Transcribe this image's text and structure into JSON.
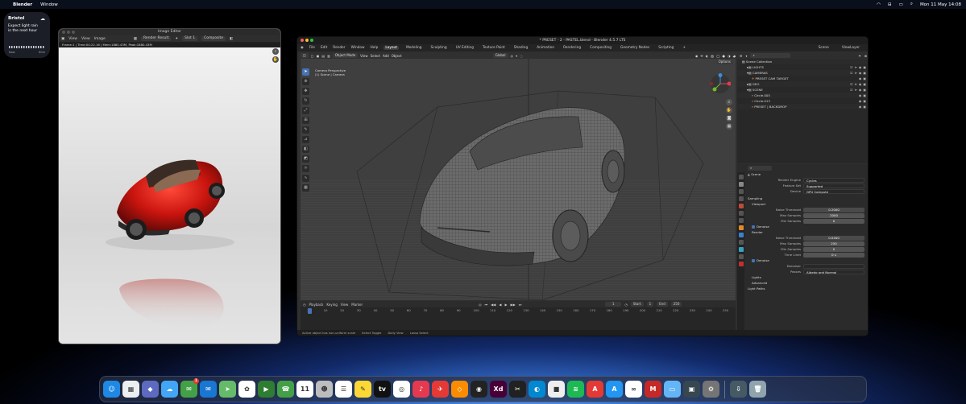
{
  "menubar": {
    "app": "Blender",
    "items": [
      "Window"
    ],
    "clock": "Mon 11 May  14:08"
  },
  "widget": {
    "city": "Bristol",
    "description": "Expect light rain in the next hour",
    "time_start": "Now",
    "time_end": "60m"
  },
  "image_editor": {
    "title": "Image Editor",
    "menu": [
      "View",
      "View",
      "Image"
    ],
    "image_name": "Render Result",
    "slot": "Slot 1",
    "pass": "Composite",
    "info": "Frame:1 | Time:04:22.16 | Mem:1880.43M, Peak:1880.43M"
  },
  "blender": {
    "title": "* PRESET - 2 - PASTEL.blend - Blender 4.5.7 LTS",
    "menu": [
      "File",
      "Edit",
      "Render",
      "Window",
      "Help"
    ],
    "workspaces": [
      "Layout",
      "Modeling",
      "Sculpting",
      "UV Editing",
      "Texture Paint",
      "Shading",
      "Animation",
      "Rendering",
      "Compositing",
      "Geometry Nodes",
      "Scripting",
      "+"
    ],
    "scene": "Scene",
    "view_layer": "ViewLayer",
    "viewport": {
      "mode": "Object Mode",
      "menu": [
        "View",
        "Select",
        "Add",
        "Object"
      ],
      "orientation": "Global",
      "options": "Options",
      "info_line1": "Camera Perspective",
      "info_line2": "(1) Scene | Camera"
    },
    "outliner": {
      "search_placeholder": "",
      "rows": [
        {
          "label": "Scene Collection",
          "level": 0
        },
        {
          "label": "LIGHTS",
          "level": 1
        },
        {
          "label": "CAMERAS",
          "level": 1
        },
        {
          "label": "PRESET CAM TARGET",
          "level": 2
        },
        {
          "label": "GEO",
          "level": 1
        },
        {
          "label": "SCENE",
          "level": 1
        },
        {
          "label": "Circle.005",
          "level": 2
        },
        {
          "label": "Circle.013",
          "level": 2
        },
        {
          "label": "PRESET | BACKDROP",
          "level": 2
        }
      ]
    },
    "properties": {
      "context": "Scene",
      "render_engine_label": "Render Engine",
      "render_engine": "Cycles",
      "feature_set_label": "Feature Set",
      "feature_set": "Supported",
      "device_label": "Device",
      "device": "GPU Compute",
      "sampling": "Sampling",
      "viewport": "Viewport",
      "noise_threshold_label": "Noise Threshold",
      "vp_noise_threshold": "0.2000",
      "max_samples_label": "Max Samples",
      "vp_max_samples": "2000",
      "min_samples_label": "Min Samples",
      "vp_min_samples": "0",
      "denoise": "Denoise",
      "render": "Render",
      "r_noise_threshold": "0.0400",
      "r_max_samples": "250",
      "r_min_samples": "0",
      "time_limit_label": "Time Limit",
      "r_time_limit": "0 s",
      "denoiser_label": "Denoiser",
      "passes_label": "Passes",
      "passes": "Albedo and Normal",
      "lights": "Lights",
      "advanced": "Advanced",
      "light_paths": "Light Paths",
      "version": "4.5.7"
    },
    "timeline": {
      "menu": [
        "Playback",
        "Keying",
        "View",
        "Marker"
      ],
      "current_frame": "1",
      "start_label": "Start",
      "start": "1",
      "end_label": "End",
      "end": "250",
      "ticks": [
        "1",
        "10",
        "20",
        "30",
        "40",
        "50",
        "60",
        "70",
        "80",
        "90",
        "100",
        "110",
        "120",
        "130",
        "140",
        "150",
        "160",
        "170",
        "180",
        "190",
        "200",
        "210",
        "220",
        "230",
        "240",
        "250"
      ]
    },
    "status_bar": [
      "Active object has non-uniform scale",
      "Select Toggle",
      "Dolly View",
      "Lasso Select"
    ]
  },
  "dock": {
    "apps": [
      {
        "name": "finder",
        "color": "#1e88e5",
        "glyph": "☺"
      },
      {
        "name": "launchpad",
        "color": "#eceff1",
        "glyph": "▦"
      },
      {
        "name": "affinity",
        "color": "#5c6bc0",
        "glyph": "◆"
      },
      {
        "name": "weather",
        "color": "#42a5f5",
        "glyph": "☁"
      },
      {
        "name": "messages",
        "color": "#43a047",
        "glyph": "✉",
        "badge": "1"
      },
      {
        "name": "mail",
        "color": "#1976d2",
        "glyph": "✉"
      },
      {
        "name": "maps",
        "color": "#66bb6a",
        "glyph": "➤"
      },
      {
        "name": "photos",
        "color": "#ffffff",
        "glyph": "✿"
      },
      {
        "name": "facetime",
        "color": "#2e7d32",
        "glyph": "▶"
      },
      {
        "name": "phone",
        "color": "#43a047",
        "glyph": "☎"
      },
      {
        "name": "calendar",
        "color": "#ffffff",
        "glyph": "11"
      },
      {
        "name": "contacts",
        "color": "#bdbdbd",
        "glyph": "☻"
      },
      {
        "name": "reminders",
        "color": "#ffffff",
        "glyph": "☰"
      },
      {
        "name": "notes",
        "color": "#fdd835",
        "glyph": "✎"
      },
      {
        "name": "apple-tv",
        "color": "#111111",
        "glyph": "tv"
      },
      {
        "name": "teams",
        "color": "#ffffff",
        "glyph": "◎"
      },
      {
        "name": "music",
        "color": "#e53950",
        "glyph": "♪"
      },
      {
        "name": "rocket",
        "color": "#e53935",
        "glyph": "✈"
      },
      {
        "name": "sketch",
        "color": "#fb8c00",
        "glyph": "◇"
      },
      {
        "name": "blender",
        "color": "#222222",
        "glyph": "◉"
      },
      {
        "name": "xd",
        "color": "#470137",
        "glyph": "Xd"
      },
      {
        "name": "final-cut",
        "color": "#212121",
        "glyph": "✂"
      },
      {
        "name": "edge",
        "color": "#0288d1",
        "glyph": "◐"
      },
      {
        "name": "cube-app",
        "color": "#eeeeee",
        "glyph": "■"
      },
      {
        "name": "spotify",
        "color": "#1db954",
        "glyph": "≋"
      },
      {
        "name": "acrobat",
        "color": "#e53935",
        "glyph": "A"
      },
      {
        "name": "app-store",
        "color": "#2196f3",
        "glyph": "A"
      },
      {
        "name": "creative-cloud",
        "color": "#ffffff",
        "glyph": "∞"
      },
      {
        "name": "toolbox",
        "color": "#c62828",
        "glyph": "M"
      },
      {
        "name": "preview",
        "color": "#64b5f6",
        "glyph": "▭"
      },
      {
        "name": "keyboard-app",
        "color": "#37474f",
        "glyph": "▣"
      },
      {
        "name": "system-settings",
        "color": "#757575",
        "glyph": "⚙"
      },
      {
        "name": "downloads",
        "color": "#455a64",
        "glyph": "⇩"
      },
      {
        "name": "trash",
        "color": "#90a4ae",
        "glyph": "🗑"
      }
    ]
  }
}
